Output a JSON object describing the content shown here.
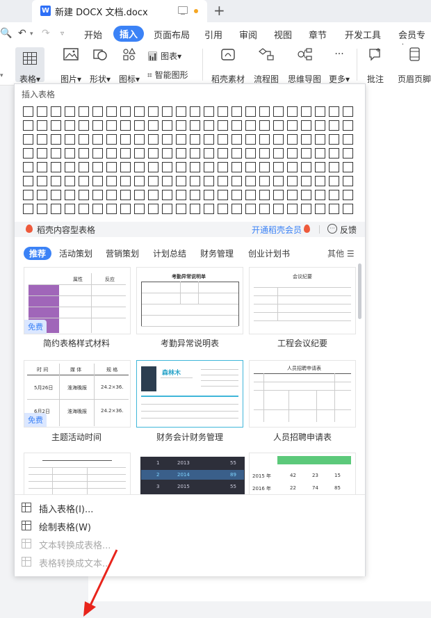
{
  "tab": {
    "title": "新建 DOCX 文档.docx",
    "plus": "+"
  },
  "menu": {
    "undo": "↶",
    "redo": "↷",
    "items": [
      "开始",
      "插入",
      "页面布局",
      "引用",
      "审阅",
      "视图",
      "章节",
      "开发工具",
      "会员专享"
    ],
    "active_index": 1
  },
  "ribbon": {
    "table": "表格",
    "picture": "图片",
    "shape": "形状",
    "icon": "图标",
    "chart": "图表",
    "smartart": "智能图形",
    "material": "稻壳素材",
    "flowchart": "流程图",
    "mindmap": "思维导图",
    "more": "更多",
    "comment": "批注",
    "header_footer": "页眉页脚"
  },
  "panel": {
    "heading": "插入表格",
    "promo_left": "稻壳内容型表格",
    "promo_vip": "开通稻壳会员",
    "promo_feedback": "反馈",
    "categories": [
      "推荐",
      "活动策划",
      "营销策划",
      "计划总结",
      "财务管理",
      "创业计划书"
    ],
    "more": "其他 ☰",
    "templates": [
      {
        "caption": "简约表格样式材料",
        "free": "免费"
      },
      {
        "caption": "考勤异常说明表"
      },
      {
        "caption": "工程会议纪要"
      },
      {
        "caption": "主题活动时间",
        "free": "免费"
      },
      {
        "caption": "财务会计财务管理"
      },
      {
        "caption": "人员招聘申请表"
      }
    ],
    "thumb_text": {
      "t1_cols": [
        "材料",
        "属性",
        "反应"
      ],
      "t2_title": "考勤异常说明单",
      "t3_title": "会议纪要",
      "t4_cols": [
        "时  间",
        "媒  体",
        "规  格"
      ],
      "t4_rows": [
        [
          "5月26日",
          "淮海晚报",
          "24.2×36."
        ],
        [
          "6月2日",
          "淮海晚报",
          "24.2×36."
        ]
      ],
      "t5_name": "森林木",
      "t6_title": "人员招聘申请表",
      "t8_rows": [
        [
          "1",
          "2013",
          "55"
        ],
        [
          "2",
          "2014",
          "89"
        ],
        [
          "3",
          "2015",
          "55"
        ]
      ],
      "t9_rows": [
        [
          "2015 年",
          "42",
          "23",
          "15"
        ],
        [
          "2016 年",
          "22",
          "74",
          "85"
        ]
      ]
    },
    "bottom_menu": [
      {
        "label": "插入表格(I)...",
        "enabled": true
      },
      {
        "label": "绘制表格(W)",
        "enabled": true
      },
      {
        "label": "文本转换成表格...",
        "enabled": false
      },
      {
        "label": "表格转换成文本...",
        "enabled": false
      }
    ]
  },
  "colors": {
    "accent": "#3b82f6",
    "purple": "#a066b9",
    "arrow": "#e8241b"
  }
}
